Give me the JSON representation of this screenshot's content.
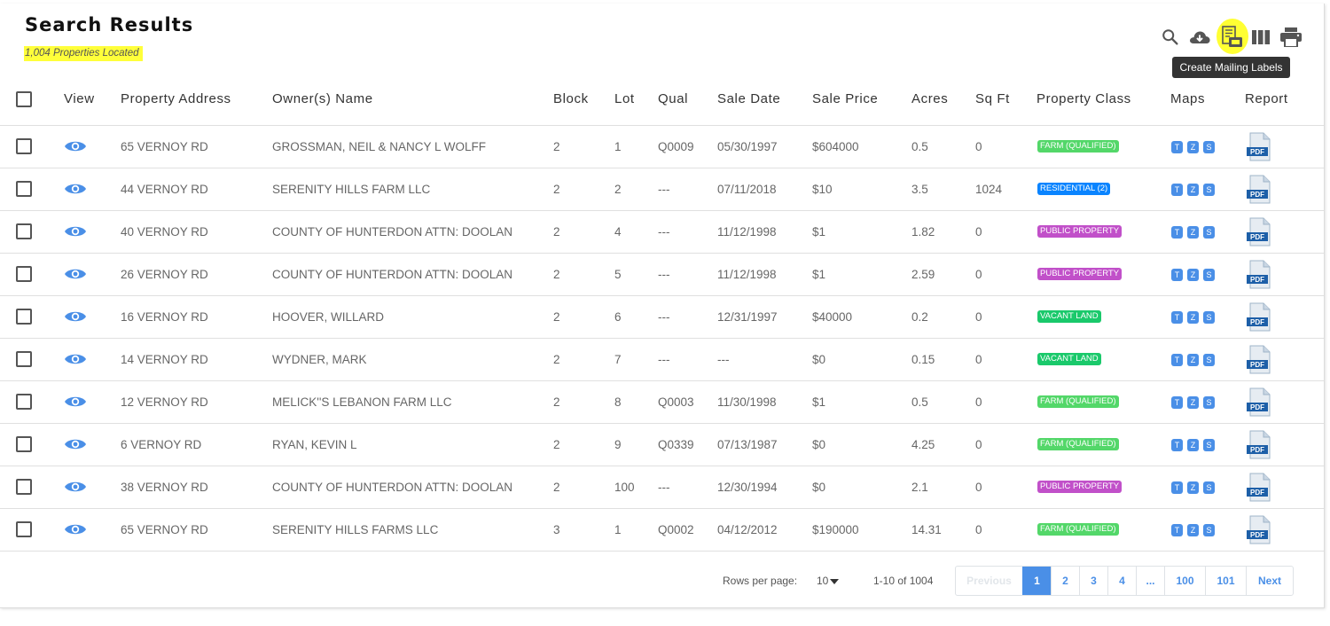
{
  "title": "Search Results",
  "subtitle": "1,004 Properties Located",
  "toolbar": {
    "tooltip": "Create Mailing Labels"
  },
  "columns": {
    "view": "View",
    "address": "Property Address",
    "owner": "Owner(s) Name",
    "block": "Block",
    "lot": "Lot",
    "qual": "Qual",
    "sale_date": "Sale Date",
    "sale_price": "Sale Price",
    "acres": "Acres",
    "sqft": "Sq Ft",
    "class": "Property Class",
    "maps": "Maps",
    "report": "Report"
  },
  "map_buttons": {
    "t": "T",
    "z": "Z",
    "s": "S"
  },
  "pdf_label": "PDF",
  "class_colors": {
    "farm": "#53d769",
    "residential": "#0a84ff",
    "public": "#c150c9",
    "vacant": "#1ac96b"
  },
  "rows": [
    {
      "address": "65 VERNOY RD",
      "owner": "GROSSMAN, NEIL & NANCY L WOLFF",
      "block": "2",
      "lot": "1",
      "qual": "Q0009",
      "sale_date": "05/30/1997",
      "sale_price": "$604000",
      "acres": "0.5",
      "sqft": "0",
      "class": "FARM (QUALIFIED)",
      "class_type": "farm"
    },
    {
      "address": "44 VERNOY RD",
      "owner": "SERENITY HILLS FARM LLC",
      "block": "2",
      "lot": "2",
      "qual": "---",
      "sale_date": "07/11/2018",
      "sale_price": "$10",
      "acres": "3.5",
      "sqft": "1024",
      "class": "RESIDENTIAL (2)",
      "class_type": "residential"
    },
    {
      "address": "40 VERNOY RD",
      "owner": "COUNTY OF HUNTERDON ATTN: DOOLAN",
      "block": "2",
      "lot": "4",
      "qual": "---",
      "sale_date": "11/12/1998",
      "sale_price": "$1",
      "acres": "1.82",
      "sqft": "0",
      "class": "PUBLIC PROPERTY",
      "class_type": "public"
    },
    {
      "address": "26 VERNOY RD",
      "owner": "COUNTY OF HUNTERDON ATTN: DOOLAN",
      "block": "2",
      "lot": "5",
      "qual": "---",
      "sale_date": "11/12/1998",
      "sale_price": "$1",
      "acres": "2.59",
      "sqft": "0",
      "class": "PUBLIC PROPERTY",
      "class_type": "public"
    },
    {
      "address": "16 VERNOY RD",
      "owner": "HOOVER, WILLARD",
      "block": "2",
      "lot": "6",
      "qual": "---",
      "sale_date": "12/31/1997",
      "sale_price": "$40000",
      "acres": "0.2",
      "sqft": "0",
      "class": "VACANT LAND",
      "class_type": "vacant"
    },
    {
      "address": "14 VERNOY RD",
      "owner": "WYDNER, MARK",
      "block": "2",
      "lot": "7",
      "qual": "---",
      "sale_date": "---",
      "sale_price": "$0",
      "acres": "0.15",
      "sqft": "0",
      "class": "VACANT LAND",
      "class_type": "vacant"
    },
    {
      "address": "12 VERNOY RD",
      "owner": "MELICK''S LEBANON FARM LLC",
      "block": "2",
      "lot": "8",
      "qual": "Q0003",
      "sale_date": "11/30/1998",
      "sale_price": "$1",
      "acres": "0.5",
      "sqft": "0",
      "class": "FARM (QUALIFIED)",
      "class_type": "farm"
    },
    {
      "address": "6 VERNOY RD",
      "owner": "RYAN, KEVIN L",
      "block": "2",
      "lot": "9",
      "qual": "Q0339",
      "sale_date": "07/13/1987",
      "sale_price": "$0",
      "acres": "4.25",
      "sqft": "0",
      "class": "FARM (QUALIFIED)",
      "class_type": "farm"
    },
    {
      "address": "38 VERNOY RD",
      "owner": "COUNTY OF HUNTERDON ATTN: DOOLAN",
      "block": "2",
      "lot": "100",
      "qual": "---",
      "sale_date": "12/30/1994",
      "sale_price": "$0",
      "acres": "2.1",
      "sqft": "0",
      "class": "PUBLIC PROPERTY",
      "class_type": "public"
    },
    {
      "address": "65 VERNOY RD",
      "owner": "SERENITY HILLS FARMS LLC",
      "block": "3",
      "lot": "1",
      "qual": "Q0002",
      "sale_date": "04/12/2012",
      "sale_price": "$190000",
      "acres": "14.31",
      "sqft": "0",
      "class": "FARM (QUALIFIED)",
      "class_type": "farm"
    }
  ],
  "footer": {
    "rows_per_page_label": "Rows per page:",
    "rows_per_page_value": "10",
    "range": "1-10 of 1004",
    "pages": [
      {
        "label": "Previous",
        "state": "disabled"
      },
      {
        "label": "1",
        "state": "active"
      },
      {
        "label": "2",
        "state": "normal"
      },
      {
        "label": "3",
        "state": "normal"
      },
      {
        "label": "4",
        "state": "normal"
      },
      {
        "label": "...",
        "state": "normal"
      },
      {
        "label": "100",
        "state": "normal"
      },
      {
        "label": "101",
        "state": "normal"
      },
      {
        "label": "Next",
        "state": "normal"
      }
    ]
  }
}
